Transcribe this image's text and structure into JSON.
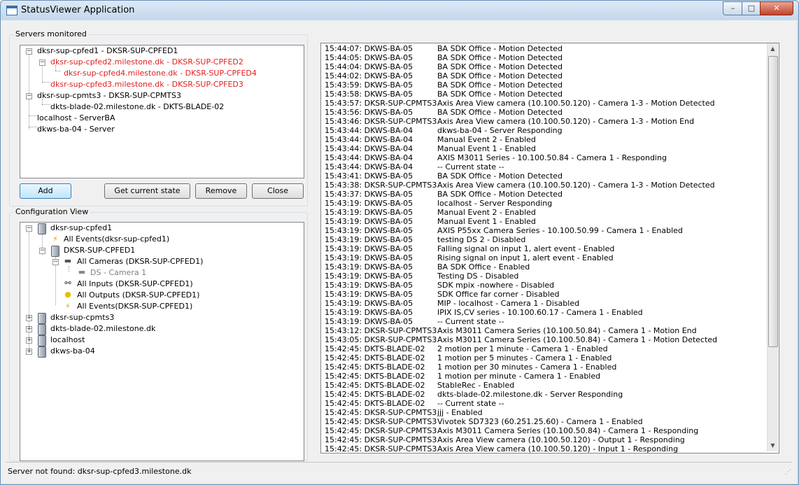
{
  "window": {
    "title": "StatusViewer Application",
    "minimize": "–",
    "maximize": "□",
    "close": "✕"
  },
  "servers": {
    "group_label": "Servers monitored",
    "nodes": [
      "dksr-sup-cpfed1 - DKSR-SUP-CPFED1",
      "dksr-sup-cpfed2.milestone.dk - DKSR-SUP-CPFED2",
      "dksr-sup-cpfed4.milestone.dk - DKSR-SUP-CPFED4",
      "dksr-sup-cpfed3.milestone.dk - DKSR-SUP-CPFED3",
      "dksr-sup-cpmts3 - DKSR-SUP-CPMTS3",
      "dkts-blade-02.milestone.dk - DKTS-BLADE-02",
      "localhost - ServerBA",
      "dkws-ba-04 - Server"
    ],
    "error_color": "#e02020"
  },
  "buttons": {
    "add": "Add",
    "get_state": "Get current state",
    "remove": "Remove",
    "close": "Close"
  },
  "config": {
    "group_label": "Configuration View",
    "nodes": [
      "dksr-sup-cpfed1",
      "All Events(dksr-sup-cpfed1)",
      "DKSR-SUP-CPFED1",
      "All Cameras (DKSR-SUP-CPFED1)",
      "DS - Camera 1",
      "All Inputs (DKSR-SUP-CPFED1)",
      "All Outputs (DKSR-SUP-CPFED1)",
      "All Events(DKSR-SUP-CPFED1)",
      "dksr-sup-cpmts3",
      "dkts-blade-02.milestone.dk",
      "localhost",
      "dkws-ba-04"
    ],
    "icons": [
      "server-icon",
      "lightning-icon",
      "server-icon",
      "camera-icon",
      "camera-icon",
      "input-icon",
      "bulb-icon",
      "lightning-icon",
      "server-icon",
      "server-icon",
      "server-icon",
      "server-icon"
    ]
  },
  "log": {
    "rows": [
      [
        "15:44:07: DKWS-BA-05",
        "BA SDK Office - Motion Detected"
      ],
      [
        "15:44:05: DKWS-BA-05",
        "BA SDK Office - Motion Detected"
      ],
      [
        "15:44:04: DKWS-BA-05",
        "BA SDK Office - Motion Detected"
      ],
      [
        "15:44:02: DKWS-BA-05",
        "BA SDK Office - Motion Detected"
      ],
      [
        "15:43:59: DKWS-BA-05",
        "BA SDK Office - Motion Detected"
      ],
      [
        "15:43:58: DKWS-BA-05",
        "BA SDK Office - Motion Detected"
      ],
      [
        "15:43:57: DKSR-SUP-CPMTS3",
        "Axis Area View camera (10.100.50.120) - Camera 1-3 - Motion Detected"
      ],
      [
        "15:43:56: DKWS-BA-05",
        "BA SDK Office - Motion Detected"
      ],
      [
        "15:43:46: DKSR-SUP-CPMTS3",
        "Axis Area View camera (10.100.50.120) - Camera 1-3 - Motion End"
      ],
      [
        "15:43:44: DKWS-BA-04",
        "dkws-ba-04 - Server Responding"
      ],
      [
        "15:43:44: DKWS-BA-04",
        "Manual Event 2 - Enabled"
      ],
      [
        "15:43:44: DKWS-BA-04",
        "Manual Event 1 - Enabled"
      ],
      [
        "15:43:44: DKWS-BA-04",
        "AXIS M3011 Series - 10.100.50.84 - Camera 1 - Responding"
      ],
      [
        "15:43:44: DKWS-BA-04",
        "-- Current state --"
      ],
      [
        "15:43:41: DKWS-BA-05",
        "BA SDK Office - Motion Detected"
      ],
      [
        "15:43:38: DKSR-SUP-CPMTS3",
        "Axis Area View camera (10.100.50.120) - Camera 1-3 - Motion Detected"
      ],
      [
        "15:43:37: DKWS-BA-05",
        "BA SDK Office - Motion Detected"
      ],
      [
        "15:43:19: DKWS-BA-05",
        "localhost - Server Responding"
      ],
      [
        "15:43:19: DKWS-BA-05",
        "Manual Event 2 - Enabled"
      ],
      [
        "15:43:19: DKWS-BA-05",
        "Manual Event 1 - Enabled"
      ],
      [
        "15:43:19: DKWS-BA-05",
        "AXIS P55xx Camera Series - 10.100.50.99 - Camera 1 - Enabled"
      ],
      [
        "15:43:19: DKWS-BA-05",
        "testing DS 2 - Disabled"
      ],
      [
        "15:43:19: DKWS-BA-05",
        "Falling signal on input 1, alert event - Enabled"
      ],
      [
        "15:43:19: DKWS-BA-05",
        "Rising signal on input 1, alert event - Enabled"
      ],
      [
        "15:43:19: DKWS-BA-05",
        "BA SDK Office - Enabled"
      ],
      [
        "15:43:19: DKWS-BA-05",
        "Testing DS - Disabled"
      ],
      [
        "15:43:19: DKWS-BA-05",
        "SDK mpix -nowhere - Disabled"
      ],
      [
        "15:43:19: DKWS-BA-05",
        "SDK Office far corner - Disabled"
      ],
      [
        "15:43:19: DKWS-BA-05",
        "MIP - localhost - Camera 1 - Disabled"
      ],
      [
        "15:43:19: DKWS-BA-05",
        "IPIX IS,CV series - 10.100.60.17 - Camera 1 - Enabled"
      ],
      [
        "15:43:19: DKWS-BA-05",
        "-- Current state --"
      ],
      [
        "15:43:12: DKSR-SUP-CPMTS3",
        "Axis M3011 Camera Series (10.100.50.84) - Camera 1 - Motion End"
      ],
      [
        "15:43:05: DKSR-SUP-CPMTS3",
        "Axis M3011 Camera Series (10.100.50.84) - Camera 1 - Motion Detected"
      ],
      [
        "15:42:45: DKTS-BLADE-02",
        "2 motion per 1 minute - Camera 1 - Enabled"
      ],
      [
        "15:42:45: DKTS-BLADE-02",
        "1 motion per 5 minutes - Camera 1 - Enabled"
      ],
      [
        "15:42:45: DKTS-BLADE-02",
        "1 motion per 30 minutes - Camera 1 - Enabled"
      ],
      [
        "15:42:45: DKTS-BLADE-02",
        "1 motion per minute - Camera 1 - Enabled"
      ],
      [
        "15:42:45: DKTS-BLADE-02",
        "StableRec - Enabled"
      ],
      [
        "15:42:45: DKTS-BLADE-02",
        "dkts-blade-02.milestone.dk - Server Responding"
      ],
      [
        "15:42:45: DKTS-BLADE-02",
        "-- Current state --"
      ],
      [
        "15:42:45: DKSR-SUP-CPMTS3",
        "jjj - Enabled"
      ],
      [
        "15:42:45: DKSR-SUP-CPMTS3",
        "Vivotek SD7323 (60.251.25.60) - Camera 1 - Enabled"
      ],
      [
        "15:42:45: DKSR-SUP-CPMTS3",
        "Axis M3011 Camera Series (10.100.50.84) - Camera 1 - Responding"
      ],
      [
        "15:42:45: DKSR-SUP-CPMTS3",
        "Axis Area View camera (10.100.50.120) - Output 1 - Responding"
      ],
      [
        "15:42:45: DKSR-SUP-CPMTS3",
        "Axis Area View camera (10.100.50.120) - Input 1 - Responding"
      ]
    ]
  },
  "status": {
    "text": "Server not found: dksr-sup-cpfed3.milestone.dk"
  }
}
